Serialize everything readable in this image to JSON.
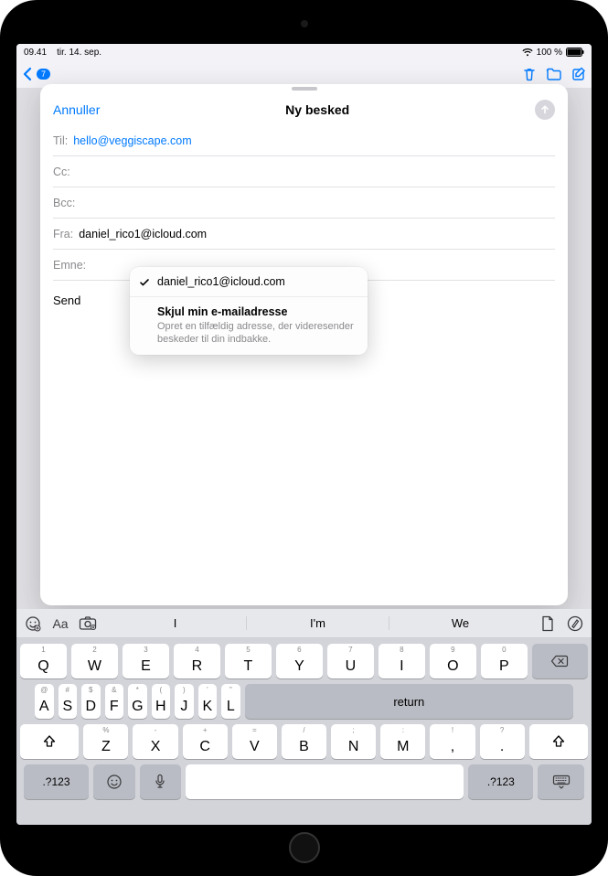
{
  "status": {
    "time": "09.41",
    "date": "tir. 14. sep.",
    "battery": "100 %"
  },
  "toolbar": {
    "unread_badge": "7"
  },
  "compose": {
    "cancel": "Annuller",
    "title": "Ny besked",
    "to_label": "Til:",
    "to_value": "hello@veggiscape.com",
    "cc_label": "Cc:",
    "bcc_label": "Bcc:",
    "from_label": "Fra:",
    "from_value": "daniel_rico1@icloud.com",
    "subject_label": "Emne:",
    "body_preview": "Send"
  },
  "popover": {
    "selected_email": "daniel_rico1@icloud.com",
    "hide_title": "Skjul min e-mailadresse",
    "hide_sub": "Opret en tilfældig adresse, der videresender beskeder til din indbakke."
  },
  "keyboard": {
    "suggestions": [
      "I",
      "I'm",
      "We"
    ],
    "row1": [
      {
        "main": "Q",
        "alt": "1"
      },
      {
        "main": "W",
        "alt": "2"
      },
      {
        "main": "E",
        "alt": "3"
      },
      {
        "main": "R",
        "alt": "4"
      },
      {
        "main": "T",
        "alt": "5"
      },
      {
        "main": "Y",
        "alt": "6"
      },
      {
        "main": "U",
        "alt": "7"
      },
      {
        "main": "I",
        "alt": "8"
      },
      {
        "main": "O",
        "alt": "9"
      },
      {
        "main": "P",
        "alt": "0"
      }
    ],
    "row2": [
      {
        "main": "A",
        "alt": "@"
      },
      {
        "main": "S",
        "alt": "#"
      },
      {
        "main": "D",
        "alt": "$"
      },
      {
        "main": "F",
        "alt": "&"
      },
      {
        "main": "G",
        "alt": "*"
      },
      {
        "main": "H",
        "alt": "("
      },
      {
        "main": "J",
        "alt": ")"
      },
      {
        "main": "K",
        "alt": "'"
      },
      {
        "main": "L",
        "alt": "\""
      }
    ],
    "row3": [
      {
        "main": "Z",
        "alt": "%"
      },
      {
        "main": "X",
        "alt": "-"
      },
      {
        "main": "C",
        "alt": "+"
      },
      {
        "main": "V",
        "alt": "="
      },
      {
        "main": "B",
        "alt": "/"
      },
      {
        "main": "N",
        "alt": ";"
      },
      {
        "main": "M",
        "alt": ":"
      },
      {
        "main": ",",
        "alt": "!"
      },
      {
        "main": ".",
        "alt": "?"
      }
    ],
    "return_label": "return",
    "numkey_label": ".?123"
  }
}
